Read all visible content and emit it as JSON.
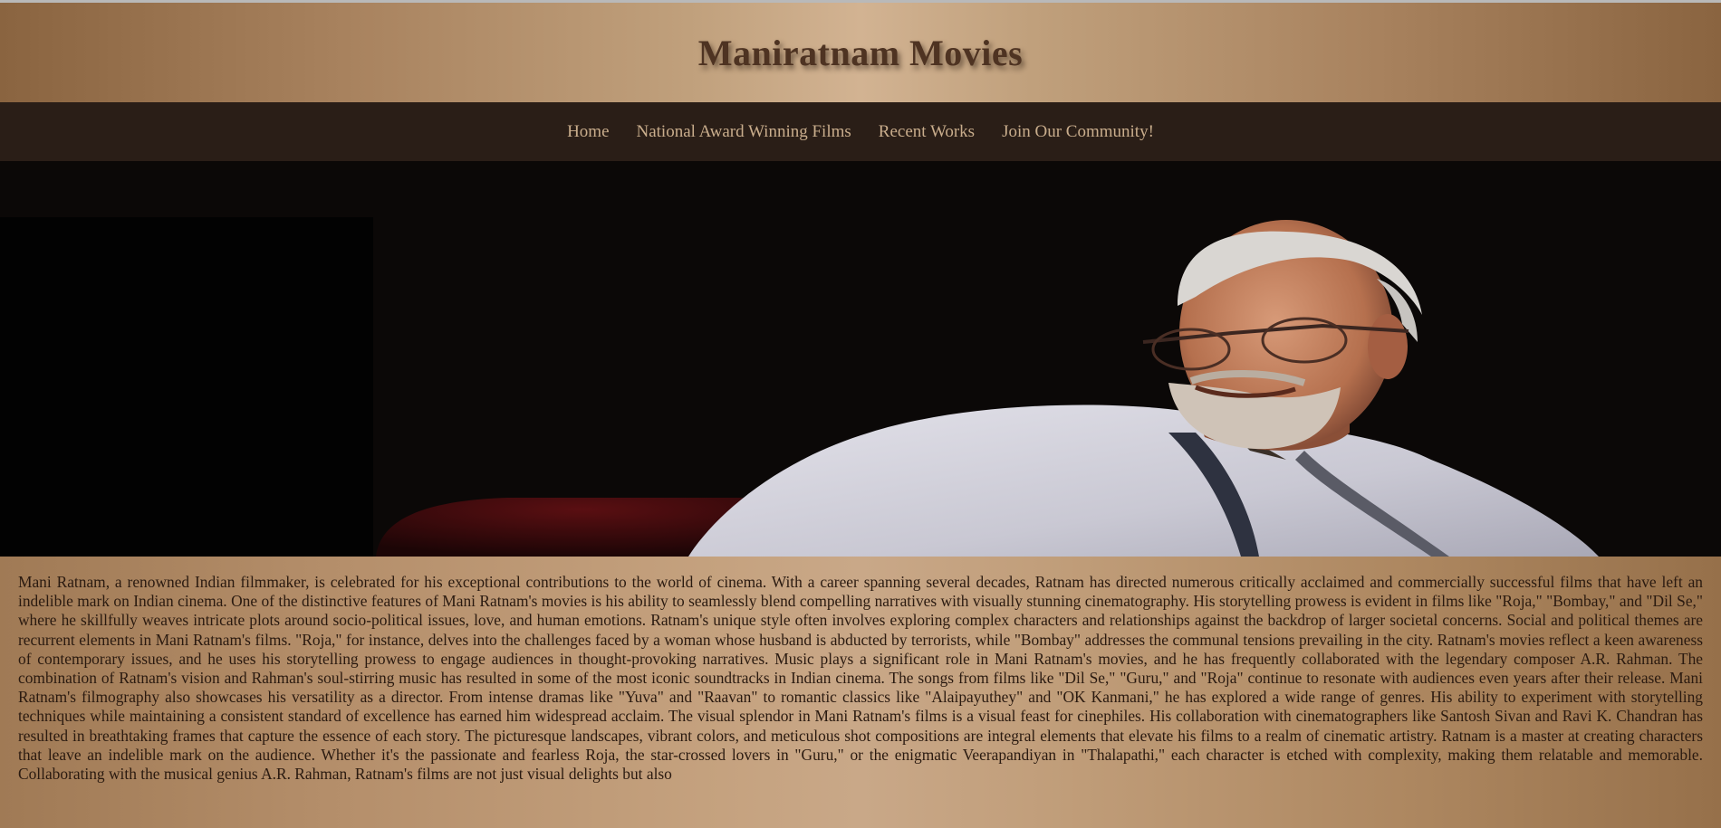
{
  "header": {
    "title": "Maniratnam Movies"
  },
  "nav": {
    "items": [
      {
        "label": "Home"
      },
      {
        "label": "National Award Winning Films"
      },
      {
        "label": "Recent Works"
      },
      {
        "label": "Join Our Community!"
      }
    ]
  },
  "hero": {
    "image_subject": "portrait-photo"
  },
  "main": {
    "paragraph": "Mani Ratnam, a renowned Indian filmmaker, is celebrated for his exceptional contributions to the world of cinema. With a career spanning several decades, Ratnam has directed numerous critically acclaimed and commercially successful films that have left an indelible mark on Indian cinema. One of the distinctive features of Mani Ratnam's movies is his ability to seamlessly blend compelling narratives with visually stunning cinematography. His storytelling prowess is evident in films like \"Roja,\" \"Bombay,\" and \"Dil Se,\" where he skillfully weaves intricate plots around socio-political issues, love, and human emotions. Ratnam's unique style often involves exploring complex characters and relationships against the backdrop of larger societal concerns. Social and political themes are recurrent elements in Mani Ratnam's films. \"Roja,\" for instance, delves into the challenges faced by a woman whose husband is abducted by terrorists, while \"Bombay\" addresses the communal tensions prevailing in the city. Ratnam's movies reflect a keen awareness of contemporary issues, and he uses his storytelling prowess to engage audiences in thought-provoking narratives. Music plays a significant role in Mani Ratnam's movies, and he has frequently collaborated with the legendary composer A.R. Rahman. The combination of Ratnam's vision and Rahman's soul-stirring music has resulted in some of the most iconic soundtracks in Indian cinema. The songs from films like \"Dil Se,\" \"Guru,\" and \"Roja\" continue to resonate with audiences even years after their release. Mani Ratnam's filmography also showcases his versatility as a director. From intense dramas like \"Yuva\" and \"Raavan\" to romantic classics like \"Alaipayuthey\" and \"OK Kanmani,\" he has explored a wide range of genres. His ability to experiment with storytelling techniques while maintaining a consistent standard of excellence has earned him widespread acclaim. The visual splendor in Mani Ratnam's films is a visual feast for cinephiles. His collaboration with cinematographers like Santosh Sivan and Ravi K. Chandran has resulted in breathtaking frames that capture the essence of each story. The picturesque landscapes, vibrant colors, and meticulous shot compositions are integral elements that elevate his films to a realm of cinematic artistry. Ratnam is a master at creating characters that leave an indelible mark on the audience. Whether it's the passionate and fearless Roja, the star-crossed lovers in \"Guru,\" or the enigmatic Veerapandiyan in \"Thalapathi,\" each character is etched with complexity, making them relatable and memorable. Collaborating with the musical genius A.R. Rahman, Ratnam's films are not just visual delights but also"
  },
  "colors": {
    "header_text": "#4e3322",
    "nav_bg": "#2a1e17",
    "nav_text": "#c9ad8c",
    "hero_bg": "#0b0807",
    "body_text": "#2a1a10"
  }
}
